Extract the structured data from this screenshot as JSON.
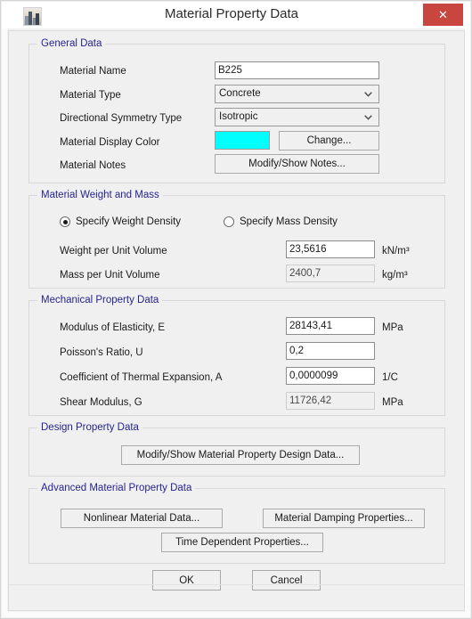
{
  "window": {
    "title": "Material Property Data",
    "app_icon": "building-skyline-icon",
    "close_label": "✕"
  },
  "general_data": {
    "legend": "General Data",
    "material_name": {
      "label": "Material Name",
      "value": "B225",
      "placeholder": ""
    },
    "material_type": {
      "label": "Material Type",
      "value": "Concrete"
    },
    "directional_symmetry_type": {
      "label": "Directional Symmetry Type",
      "value": "Isotropic"
    },
    "material_display_color": {
      "label": "Material Display Color",
      "color": "#00FFFF",
      "change_label": "Change..."
    },
    "material_notes": {
      "label": "Material Notes",
      "button_label": "Modify/Show Notes..."
    }
  },
  "weight_and_mass": {
    "legend": "Material Weight and Mass",
    "radio_weight": {
      "label": "Specify Weight Density",
      "selected": true
    },
    "radio_mass": {
      "label": "Specify Mass Density",
      "selected": false
    },
    "weight_per_unit_volume": {
      "label": "Weight per Unit Volume",
      "value": "23,5616",
      "unit": "kN/m³",
      "disabled": false
    },
    "mass_per_unit_volume": {
      "label": "Mass per Unit Volume",
      "value": "2400,7",
      "unit": "kg/m³",
      "disabled": true
    }
  },
  "mechanical_property_data": {
    "legend": "Mechanical Property Data",
    "modulus_of_elasticity": {
      "label": "Modulus of Elasticity,  E",
      "value": "28143,41",
      "unit": "MPa",
      "disabled": false
    },
    "poissons_ratio": {
      "label": "Poisson's Ratio,  U",
      "value": "0,2",
      "unit": "",
      "disabled": false
    },
    "coefficient_of_thermal_expansion": {
      "label": "Coefficient of Thermal Expansion,  A",
      "value": "0,0000099",
      "unit": "1/C",
      "disabled": false
    },
    "shear_modulus": {
      "label": "Shear Modulus,  G",
      "value": "11726,42",
      "unit": "MPa",
      "disabled": true
    }
  },
  "design_property_data": {
    "legend": "Design Property Data",
    "modify_show_design_data": "Modify/Show Material Property Design Data..."
  },
  "advanced_material_property_data": {
    "legend": "Advanced Material Property Data",
    "nonlinear_material_data": "Nonlinear Material Data...",
    "material_damping_properties": "Material Damping Properties...",
    "time_dependent_properties": "Time Dependent Properties..."
  },
  "footer": {
    "ok_label": "OK",
    "cancel_label": "Cancel"
  },
  "colors": {
    "dialog_background": "#F0F0F0",
    "legend_text": "#26258F",
    "close_button": "#C9453F",
    "display_color": "#00FFFF"
  }
}
